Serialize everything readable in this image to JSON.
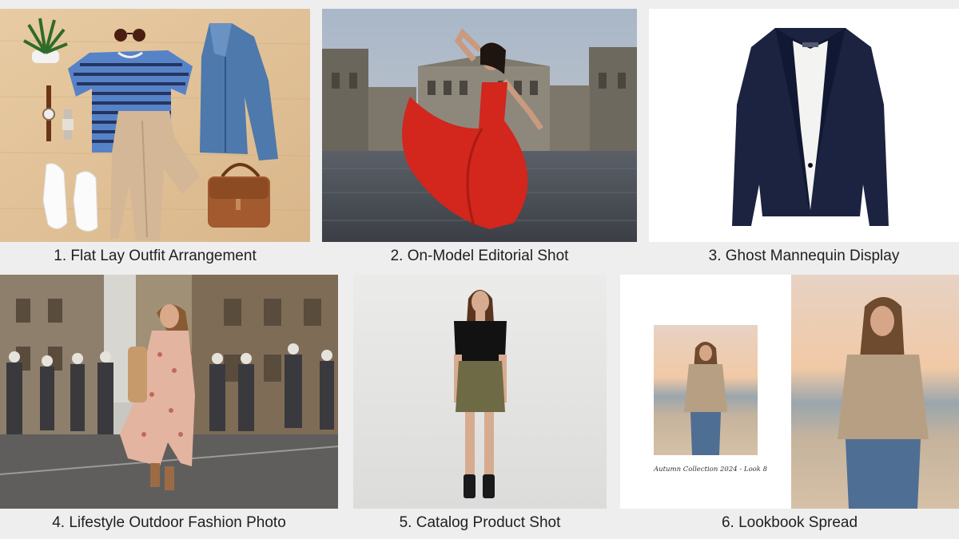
{
  "captions": {
    "c1": {
      "number": "1.",
      "text": "Flat Lay Outfit Arrangement"
    },
    "c2": {
      "number": "2.",
      "text": "On-Model Editorial Shot"
    },
    "c3": {
      "number": "3.",
      "text": "Ghost Mannequin Display"
    },
    "c4": {
      "number": "4.",
      "text": "Lifestyle Outdoor Fashion Photo"
    },
    "c5": {
      "number": "5.",
      "text": "Catalog Product Shot"
    },
    "c6": {
      "number": "6.",
      "text": "Lookbook Spread"
    }
  },
  "lookbook": {
    "page_caption": "Autumn Collection 2024 - Look 8"
  },
  "colors": {
    "background": "#eeeeee",
    "wood": "#e3c49b",
    "editorial_dress": "#d3261c",
    "blazer": "#1c2340",
    "skirt": "#6d6a45",
    "sweater": "#b79f83"
  },
  "images": {
    "flat_lay": [
      "plant-icon",
      "sunglasses-icon",
      "striped-tshirt",
      "denim-jacket",
      "watch",
      "beige-trousers",
      "white-sneakers",
      "brown-crossbody-bag"
    ],
    "editorial": [
      "model-red-gown",
      "palace-square"
    ],
    "ghost": [
      "navy-blazer",
      "white-blouse"
    ],
    "lifestyle": [
      "woman-floral-dress",
      "city-street-crowd"
    ],
    "catalog": [
      "model-black-top-olive-skirt"
    ],
    "lookbook": [
      "left-page-beach-portrait",
      "right-page-beach-portrait"
    ]
  }
}
